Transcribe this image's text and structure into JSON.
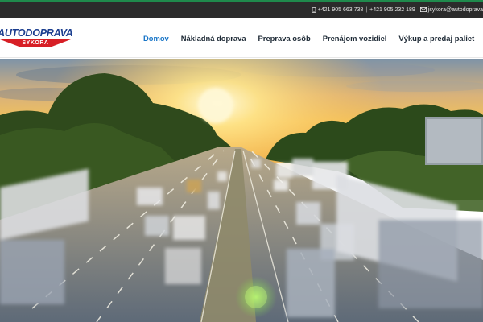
{
  "topbar": {
    "phone_1": "+421 905 663 738",
    "separator": "|",
    "phone_2": "+421 905 232 189",
    "email": "jsykora@autodoprava"
  },
  "logo": {
    "main_text": "AUTODOPRAVA",
    "sub_text": "SYKORA"
  },
  "nav": {
    "items": [
      {
        "label": "Domov",
        "active": true
      },
      {
        "label": "Nákladná doprava",
        "active": false
      },
      {
        "label": "Preprava osôb",
        "active": false
      },
      {
        "label": "Prenájom vozidiel",
        "active": false
      },
      {
        "label": "Výkup a predaj paliet",
        "active": false
      }
    ]
  },
  "colors": {
    "accent": "#1976c8",
    "logo_blue": "#1b3e8f",
    "logo_red": "#d71f26",
    "topbar_bg": "#2b2b2b"
  },
  "icons": {
    "phone": "phone-icon",
    "email": "envelope-icon"
  }
}
